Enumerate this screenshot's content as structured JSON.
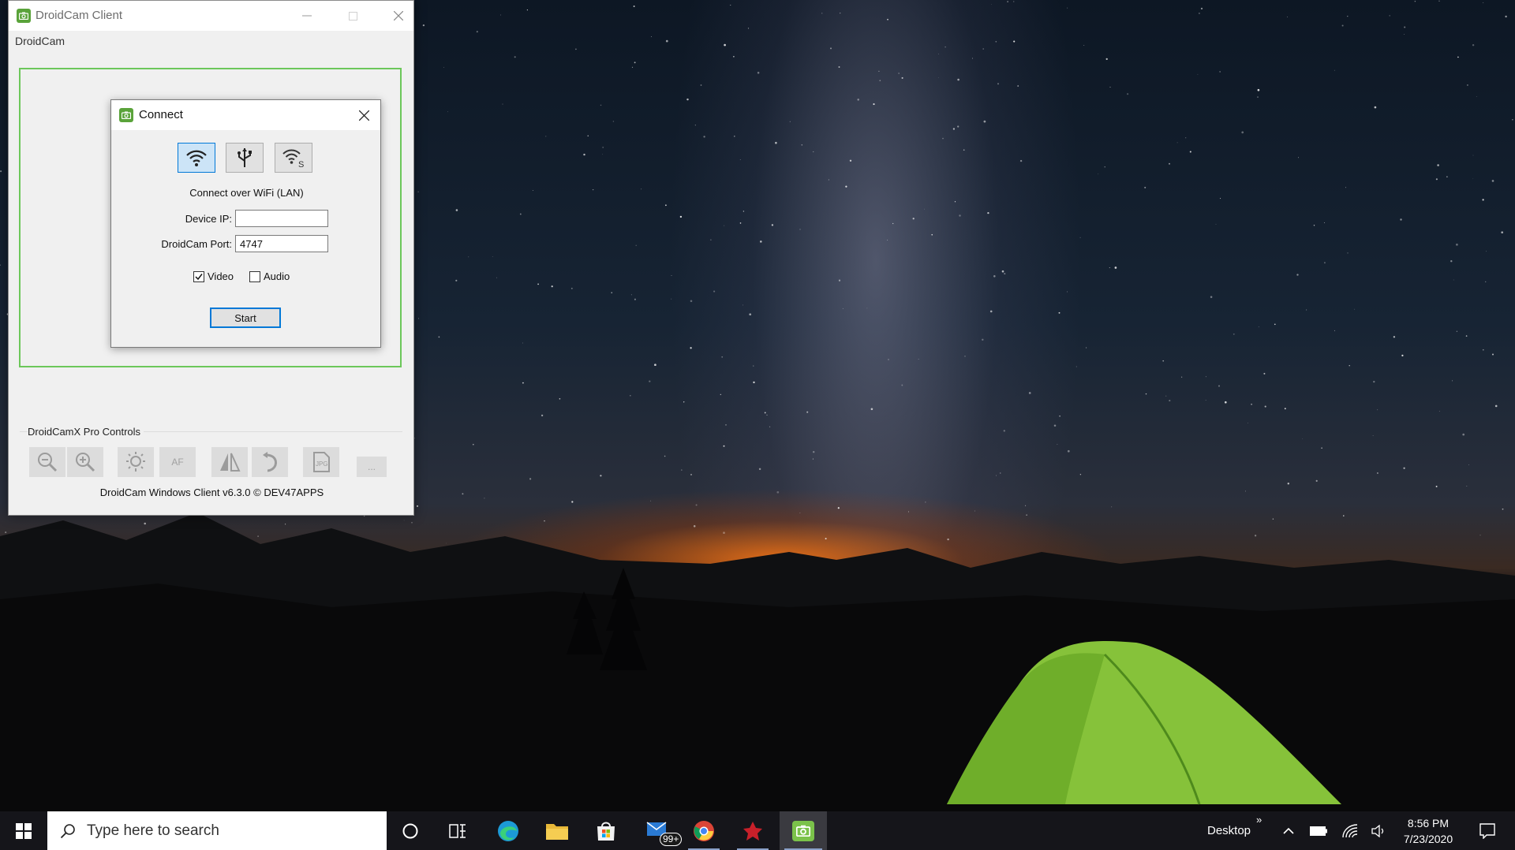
{
  "window": {
    "title": "DroidCam Client",
    "menu_label": "DroidCam",
    "pro_controls_label": "DroidCamX Pro Controls",
    "tools": {
      "zoom_out": "zoom-out-icon",
      "zoom_in": "zoom-in-icon",
      "light": "light-icon",
      "af": "AF",
      "flip": "flip-icon",
      "rotate": "rotate-icon",
      "jpg": "JPG",
      "more": "..."
    },
    "footer": "DroidCam Windows Client v6.3.0 © DEV47APPS"
  },
  "dialog": {
    "title": "Connect",
    "connection_types": [
      "wifi",
      "usb",
      "wifi-server"
    ],
    "mode_text": "Connect over WiFi (LAN)",
    "device_ip_label": "Device IP:",
    "device_ip_value": "",
    "port_label": "DroidCam Port:",
    "port_value": "4747",
    "video_label": "Video",
    "video_checked": true,
    "audio_label": "Audio",
    "audio_checked": false,
    "start_label": "Start"
  },
  "taskbar": {
    "search_placeholder": "Type here to search",
    "mail_badge": "99+",
    "desktop_label": "Desktop",
    "time": "8:56 PM",
    "date": "7/23/2020"
  },
  "colors": {
    "accent": "#0078d7",
    "frame_green": "#6cc75a",
    "app_icon_green": "#5aa33a",
    "taskbar": "#15151a"
  }
}
